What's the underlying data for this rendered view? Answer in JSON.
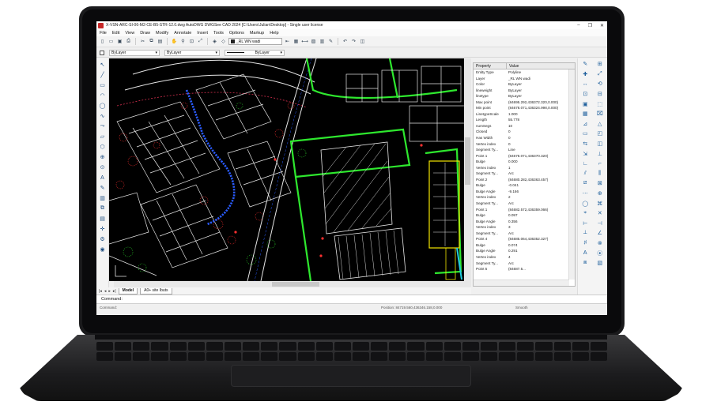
{
  "window": {
    "title": "X-VSN-ARC-SI-06-M2-CE-B5-STR-12.0.dwg AutoDWG DWGSee CAD 2024 [C:\\Users\\Julian\\Desktop] - Single user license",
    "controls": [
      "–",
      "❐",
      "✕"
    ]
  },
  "menu": [
    "File",
    "Edit",
    "View",
    "Draw",
    "Modify",
    "Annotate",
    "Insert",
    "Tools",
    "Options",
    "Markup",
    "Help"
  ],
  "toolbar": {
    "icons_left": [
      "new-icon",
      "open-icon",
      "save-icon",
      "print-icon",
      "cut-icon",
      "copy-icon",
      "paste-icon",
      "pan-icon",
      "zoom-icon",
      "zoom-window-icon",
      "zoom-extents-icon",
      "layer-icon",
      "layer-state-icon"
    ],
    "layer_value": "_RL WN wadi",
    "icons_right": [
      "layer-prev-icon",
      "block-icon",
      "measure-icon",
      "image-icon",
      "pdf-icon",
      "markup-icon",
      "undo-icon",
      "redo-icon",
      "pane-icon"
    ]
  },
  "properties_bar": {
    "color": "ByLayer",
    "layer": "ByLayer",
    "linetype": "ByLayer"
  },
  "left_tools": [
    "↖",
    "╱",
    "▭",
    "◠",
    "◯",
    "∿",
    "⤳",
    "▱",
    "⬡",
    "⊕",
    "⊙",
    "A",
    "✎",
    "▥",
    "⧉",
    "▤",
    "✛",
    "⚙",
    "◉"
  ],
  "right_tools": [
    "✎",
    "⊞",
    "✚",
    "⤢",
    "↔",
    "⟲",
    "⊡",
    "⊟",
    "▣",
    "⬚",
    "▦",
    "⌧",
    "⊿",
    "△",
    "▭",
    "◰",
    "⇆",
    "◫",
    "⇲",
    "⊥",
    "∟",
    "⌐",
    "⫽",
    "⫼",
    "⧄",
    "⊠",
    "⋯",
    "⊕",
    "◯",
    "⌘",
    "⌖",
    "✕",
    "⊢",
    "⊣",
    "⟂",
    "∠",
    "♯",
    "⊗",
    "A",
    "⦿",
    "⧈",
    "▧"
  ],
  "properties_panel": {
    "header_property": "Property",
    "header_value": "Value",
    "rows": [
      {
        "name": "Entity Type",
        "value": "Polyline"
      },
      {
        "name": "Layer",
        "value": "_RL WN wadi"
      },
      {
        "name": "Color",
        "value": "ByLayer"
      },
      {
        "name": "lineweight",
        "value": "ByLayer"
      },
      {
        "name": "linetype",
        "value": "ByLayer"
      },
      {
        "name": "Max point",
        "value": "(84695.292,436372.320,0.000)"
      },
      {
        "name": "Min point",
        "value": "(84678.071,436324.998,0.000)"
      },
      {
        "name": "LinetypeScale",
        "value": "1.000"
      },
      {
        "name": "Length",
        "value": "55.778"
      },
      {
        "name": "numSegs",
        "value": "10"
      },
      {
        "name": "Closed",
        "value": "0"
      },
      {
        "name": "Has Width",
        "value": "0"
      },
      {
        "name": "Vertex index",
        "value": "0"
      },
      {
        "name": "Segment Ty...",
        "value": "Line"
      },
      {
        "name": "Point 1",
        "value": "(84678.071,436370.320)"
      },
      {
        "name": "Bulge",
        "value": "0.000"
      },
      {
        "name": "Vertex index",
        "value": "1"
      },
      {
        "name": "Segment Ty...",
        "value": "Arc"
      },
      {
        "name": "Point 2",
        "value": "(84680.282,436363.457)"
      },
      {
        "name": "Bulge",
        "value": "-0.041"
      },
      {
        "name": "Bulge Angle",
        "value": "-9.166"
      },
      {
        "name": "Vertex index",
        "value": "2"
      },
      {
        "name": "Segment Ty...",
        "value": "Arc"
      },
      {
        "name": "Point 1",
        "value": "(84682.572,436359.066)"
      },
      {
        "name": "Bulge",
        "value": "0.097"
      },
      {
        "name": "Bulge Angle",
        "value": "0.356"
      },
      {
        "name": "Vertex index",
        "value": "3"
      },
      {
        "name": "Segment Ty...",
        "value": "Arc"
      },
      {
        "name": "Point 4",
        "value": "(84685.064,436352.327)"
      },
      {
        "name": "Bulge",
        "value": "0.074"
      },
      {
        "name": "Bulge Angle",
        "value": "0.291"
      },
      {
        "name": "Vertex index",
        "value": "4"
      },
      {
        "name": "Segment Ty...",
        "value": "Arc"
      },
      {
        "name": "Point 5",
        "value": "(84687.5..."
      }
    ]
  },
  "tabs": {
    "nav": [
      "|◂",
      "◂",
      "▸",
      "▸|"
    ],
    "items": [
      "Model",
      "A0+ site Ibuts"
    ]
  },
  "command_line": {
    "label": "Command:"
  },
  "status_bar": {
    "left": "Command:",
    "coords": "Position: 84719.560,436346.158,0.000",
    "right": "Smooth"
  },
  "colors": {
    "drawing_bg": "#000000",
    "grid_line": "#e6e6e6",
    "bright_green": "#2ee82e",
    "red_dots": "#ff3030",
    "selected_blue": "#2a5cff",
    "hatch": "#d8d8d8",
    "yellow": "#f2e600",
    "cyan": "#22d0e0"
  }
}
